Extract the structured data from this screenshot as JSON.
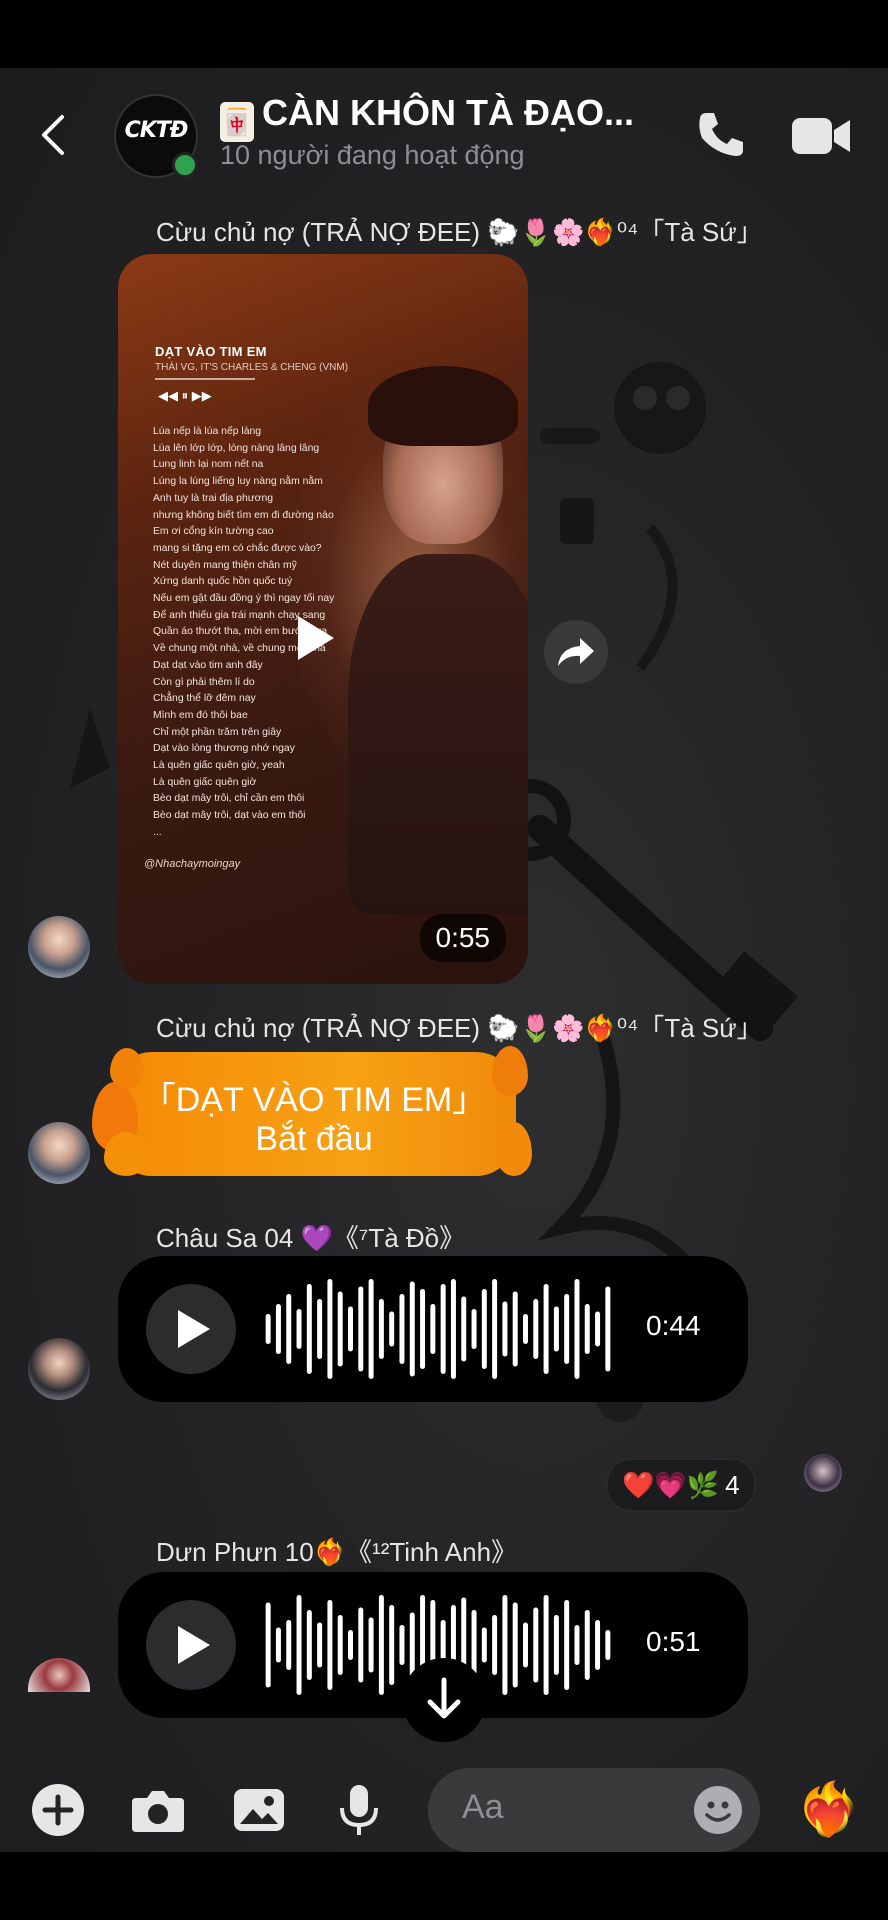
{
  "header": {
    "group_logo_text": "CKTĐ",
    "title_glyph": "🀄",
    "title": "CÀN KHÔN TÀ ĐẠO...",
    "status": "10 người đang hoạt động"
  },
  "messages": [
    {
      "sender": "Cừu chủ nợ (TRẢ NỢ ĐEE) 🐑🌷🌸❤️‍🔥⁰⁴「Tà Sứ」",
      "type": "video",
      "video": {
        "song_title": "DẠT VÀO TIM EM",
        "artists": "THÁI VG, IT'S CHARLES & CHENG (VNM)",
        "controls": "◀◀  ⏸  ▶▶",
        "lyrics": [
          "Lúa nếp là lúa nếp làng",
          "Lúa lên lớp lớp, lòng nàng lâng lâng",
          "Lung linh lại nom nết na",
          "Lúng la lúng liếng luy nàng nằm nằm",
          "Anh tuy là trai địa phương",
          "nhưng không biết tìm em đi đường nào",
          "Em ơi cổng kín tường cao",
          "mang si tặng em có chắc được vào?",
          "Nét duyên mang thiện chân mỹ",
          "Xứng danh quốc hồn quốc tuý",
          "Nếu em gật đầu đồng ý thì ngay tối nay",
          "Để anh thiếu gia trái mạnh chạy sang",
          "Quần áo thướt tha, mời em bước qua",
          "Về chung một nhà, về chung một nhà",
          "Dạt dạt vào tim anh đây",
          "Còn gì phải thêm lí do",
          "Chẳng thể lỡ đêm nay",
          "Mình em đó thôi bae",
          "Chỉ một phần trăm trên giây",
          "Dạt vào lòng thương nhớ ngay",
          "Là quên giấc quên giờ, yeah",
          "Là quên giấc quên giờ",
          "Bèo dạt mây trôi, chỉ cần em thôi",
          "Bèo dạt mây trôi, dạt vào em thôi",
          "..."
        ],
        "handle": "@Nhachaymoingay",
        "duration": "0:55"
      }
    },
    {
      "sender": "Cừu chủ nợ (TRẢ NỢ ĐEE) 🐑🌷🌸❤️‍🔥⁰⁴「Tà Sứ」",
      "type": "event",
      "line1": "「DẠT VÀO TIM EM」",
      "line2": "Bắt đầu"
    },
    {
      "sender": "Châu Sa 04 💜《⁷Tà Đồ》",
      "type": "voice",
      "duration": "0:44",
      "reactions": "❤️💗🌿",
      "reaction_count": "4"
    },
    {
      "sender": "Dưn Phưn 10❤️‍🔥《¹²Tinh Anh》",
      "type": "voice",
      "duration": "0:51"
    }
  ],
  "composer": {
    "placeholder": "Aa",
    "send_emoji": "❤️‍🔥"
  },
  "icons": {
    "back": "chevron-left-icon",
    "call": "phone-icon",
    "video": "video-camera-icon",
    "share": "share-arrow-icon",
    "add": "plus-circle-icon",
    "camera": "camera-icon",
    "gallery": "image-icon",
    "mic": "microphone-icon",
    "emoji": "smiley-icon",
    "download": "download-arrow-icon"
  },
  "colors": {
    "background": "#242426",
    "online": "#31a24c",
    "event_orange": "#f7a114",
    "voice_bubble": "#000000"
  }
}
